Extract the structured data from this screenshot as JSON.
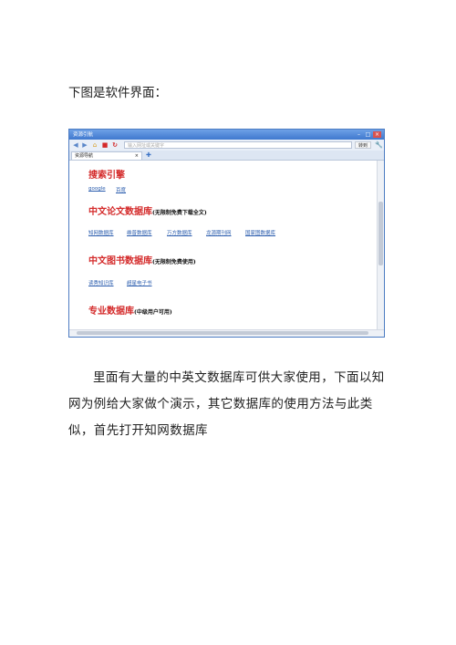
{
  "intro": "下图是软件界面：",
  "browser": {
    "title": "资源引航",
    "window_buttons": [
      "–",
      "□",
      "×"
    ],
    "address_placeholder": "输入网址或关键字",
    "go_label": "转到",
    "tab_label": "资源导航",
    "tab_close": "×",
    "sections": {
      "search": {
        "title": "搜索引擎",
        "links": [
          "google",
          "百度"
        ]
      },
      "papers": {
        "title": "中文论文数据库",
        "note": "(无限制免费下载全文)",
        "links": [
          "知网数据库",
          "维普数据库",
          "万方数据库",
          "龙源期刊网",
          "国家图数据库"
        ]
      },
      "books": {
        "title": "中文图书数据库",
        "note": "(无限制免费使用)",
        "links": [
          "读秀知识库",
          "超星电子书"
        ]
      },
      "pro": {
        "title": "专业数据库",
        "note": "(中级用户可用)"
      }
    }
  },
  "body_text": "里面有大量的中英文数据库可供大家使用，下面以知网为例给大家做个演示，其它数据库的使用方法与此类似，首先打开知网数据库"
}
